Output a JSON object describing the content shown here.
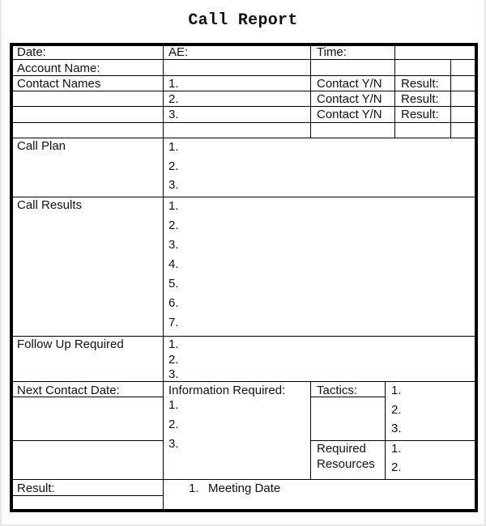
{
  "title": "Call Report",
  "header": {
    "date_label": "Date:",
    "ae_label": "AE:",
    "time_label": "Time:",
    "account_label": "Account Name:"
  },
  "contacts": {
    "label": "Contact Names",
    "rows": [
      {
        "num": "1.",
        "contact": "Contact Y/N",
        "result": "Result:"
      },
      {
        "num": "2.",
        "contact": "Contact Y/N",
        "result": "Result:"
      },
      {
        "num": "3.",
        "contact": "Contact Y/N",
        "result": "Result:"
      }
    ]
  },
  "call_plan": {
    "label": "Call Plan",
    "items": [
      "1.",
      "2.",
      "3."
    ]
  },
  "call_results": {
    "label": "Call Results",
    "items": [
      "1.",
      "2.",
      "3.",
      "4.",
      "5.",
      "6.",
      "7."
    ]
  },
  "follow_up": {
    "label": "Follow Up Required",
    "items": [
      "1.",
      "2.",
      "3."
    ]
  },
  "next_contact": {
    "label": "Next Contact Date:"
  },
  "info_required": {
    "label": "Information Required:",
    "items": [
      "1.",
      "2.",
      "3."
    ]
  },
  "tactics": {
    "label": "Tactics:",
    "items": [
      "1.",
      "2.",
      "3."
    ]
  },
  "resources": {
    "label_line1": "Required",
    "label_line2": "Resources",
    "items": [
      "1.",
      "2."
    ]
  },
  "result": {
    "label": "Result:",
    "item_num": "1.",
    "item_text": "Meeting Date"
  }
}
